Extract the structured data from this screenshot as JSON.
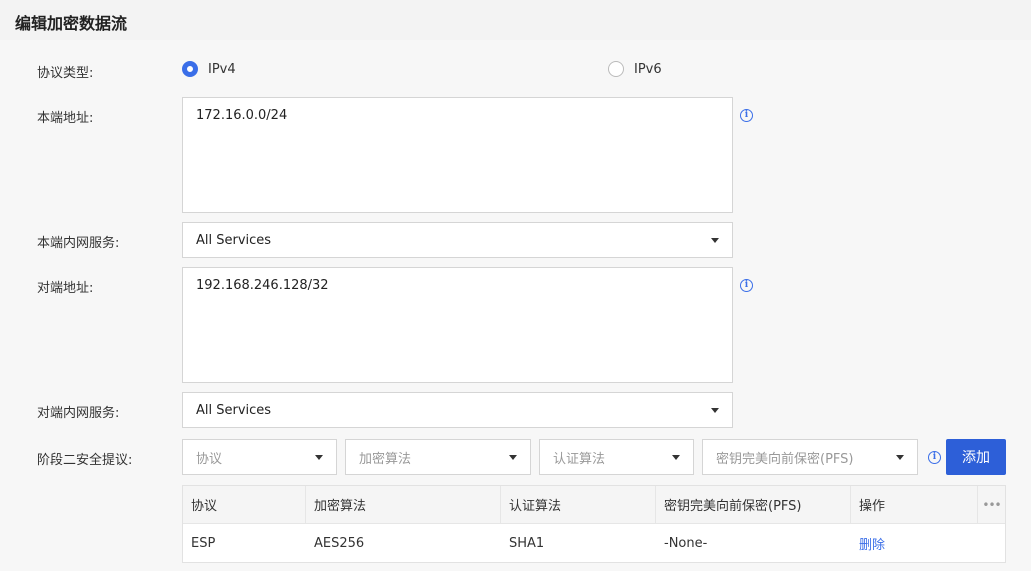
{
  "page_title": "编辑加密数据流",
  "form": {
    "protocol_type": {
      "label": "协议类型:",
      "options": [
        "IPv4",
        "IPv6"
      ],
      "selected": "IPv4"
    },
    "local_address": {
      "label": "本端地址:",
      "value": "172.16.0.0/24"
    },
    "local_service": {
      "label": "本端内网服务:",
      "value": "All Services"
    },
    "peer_address": {
      "label": "对端地址:",
      "value": "192.168.246.128/32"
    },
    "peer_service": {
      "label": "对端内网服务:",
      "value": "All Services"
    },
    "phase2": {
      "label": "阶段二安全提议:",
      "protocol_placeholder": "协议",
      "encryption_placeholder": "加密算法",
      "auth_placeholder": "认证算法",
      "pfs_placeholder": "密钥完美向前保密(PFS)",
      "add_label": "添加"
    }
  },
  "table": {
    "headers": [
      "协议",
      "加密算法",
      "认证算法",
      "密钥完美向前保密(PFS)",
      "操作"
    ],
    "rows": [
      {
        "protocol": "ESP",
        "encryption": "AES256",
        "auth": "SHA1",
        "pfs": "-None-",
        "action": "删除"
      }
    ]
  },
  "colors": {
    "accent": "#2d5fd8",
    "link": "#3a6ee8"
  },
  "icons": [
    "info-icon",
    "caret-down-icon",
    "more-icon"
  ]
}
